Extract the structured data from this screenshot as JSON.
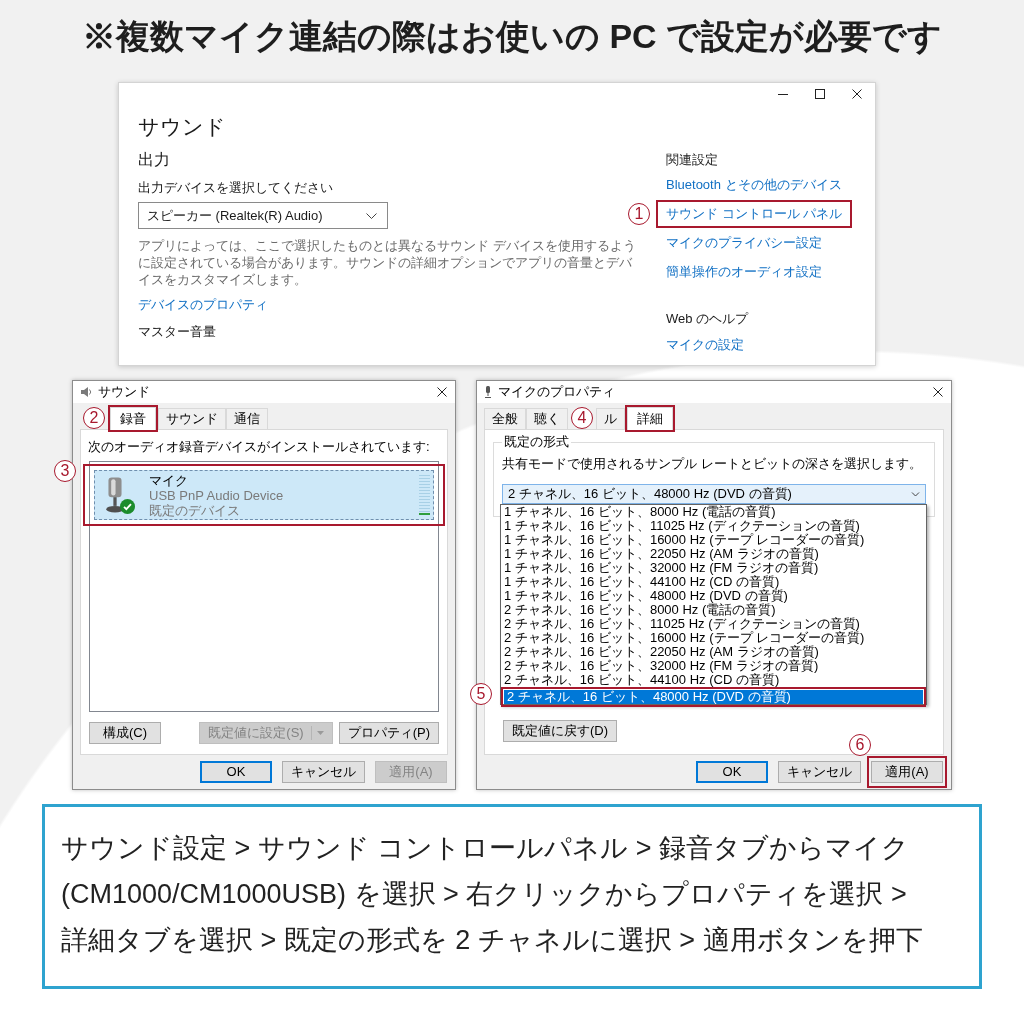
{
  "title": "※複数マイク連結の際はお使いの PC で設定が必要です",
  "settings_window": {
    "title": "サウンド",
    "output_heading": "出力",
    "device_label": "出力デバイスを選択してください",
    "device_dropdown": {
      "value": "スピーカー (Realtek(R) Audio)"
    },
    "description": "アプリによっては、ここで選択したものとは異なるサウンド デバイスを使用するように設定されている場合があります。サウンドの詳細オプションでアプリの音量とデバイスをカスタマイズします。",
    "properties_link": "デバイスのプロパティ",
    "volume_heading": "マスター音量",
    "related": {
      "heading": "関連設定",
      "links": [
        {
          "label": "Bluetooth とその他のデバイス"
        },
        {
          "label": "サウンド コントロール パネル",
          "step": "1"
        },
        {
          "label": "マイクのプライバシー設定"
        },
        {
          "label": "簡単操作のオーディオ設定"
        }
      ]
    },
    "help": {
      "heading": "Web のヘルプ",
      "links": [
        {
          "label": "マイクの設定"
        }
      ]
    }
  },
  "sound_dialog": {
    "title": "サウンド",
    "tabs": [
      {
        "label": "録音",
        "selected": true,
        "step": "2"
      },
      {
        "label": "サウンド",
        "selected": false
      },
      {
        "label": "通信",
        "selected": false
      }
    ],
    "instruction": "次のオーディオ録音デバイスがインストールされています:",
    "devices": [
      {
        "name": "マイク",
        "description": "USB PnP Audio Device",
        "status": "既定のデバイス",
        "selected": true,
        "default": true,
        "level": 0.08,
        "step": "3"
      }
    ],
    "buttons": [
      {
        "label": "構成(C)",
        "kind": "plain",
        "disabled": false
      },
      {
        "label": "既定値に設定(S)",
        "kind": "split",
        "disabled": true
      },
      {
        "label": "プロパティ(P)",
        "kind": "plain",
        "disabled": false
      }
    ],
    "footer_buttons": [
      {
        "label": "OK",
        "default": true,
        "disabled": false
      },
      {
        "label": "キャンセル",
        "default": false,
        "disabled": false
      },
      {
        "label": "適用(A)",
        "default": false,
        "disabled": true
      }
    ]
  },
  "properties_dialog": {
    "title": "マイクのプロパティ",
    "tabs": [
      {
        "label": "全般",
        "selected": false
      },
      {
        "label": "聴く",
        "selected": false
      },
      {
        "label": "ル",
        "selected": false
      },
      {
        "label": "詳細",
        "selected": true,
        "step": "4"
      }
    ],
    "format_group": {
      "heading": "既定の形式",
      "description": "共有モードで使用されるサンプル レートとビットの深さを選択します。",
      "dropdown": {
        "value": "2 チャネル、16 ビット、48000 Hz (DVD の音質)",
        "expanded": true,
        "options": [
          {
            "label": "1 チャネル、16 ビット、8000 Hz (電話の音質)",
            "selected": false
          },
          {
            "label": "1 チャネル、16 ビット、11025 Hz (ディクテーションの音質)",
            "selected": false
          },
          {
            "label": "1 チャネル、16 ビット、16000 Hz (テープ レコーダーの音質)",
            "selected": false
          },
          {
            "label": "1 チャネル、16 ビット、22050 Hz (AM ラジオの音質)",
            "selected": false
          },
          {
            "label": "1 チャネル、16 ビット、32000 Hz (FM ラジオの音質)",
            "selected": false
          },
          {
            "label": "1 チャネル、16 ビット、44100 Hz (CD の音質)",
            "selected": false
          },
          {
            "label": "1 チャネル、16 ビット、48000 Hz (DVD の音質)",
            "selected": false
          },
          {
            "label": "2 チャネル、16 ビット、8000 Hz (電話の音質)",
            "selected": false
          },
          {
            "label": "2 チャネル、16 ビット、11025 Hz (ディクテーションの音質)",
            "selected": false
          },
          {
            "label": "2 チャネル、16 ビット、16000 Hz (テープ レコーダーの音質)",
            "selected": false
          },
          {
            "label": "2 チャネル、16 ビット、22050 Hz (AM ラジオの音質)",
            "selected": false
          },
          {
            "label": "2 チャネル、16 ビット、32000 Hz (FM ラジオの音質)",
            "selected": false
          },
          {
            "label": "2 チャネル、16 ビット、44100 Hz (CD の音質)",
            "selected": false
          },
          {
            "label": "2 チャネル、16 ビット、48000 Hz (DVD の音質)",
            "selected": true,
            "step": "5"
          }
        ]
      }
    },
    "restore_button": "既定値に戻す(D)",
    "footer_buttons": [
      {
        "label": "OK",
        "default": true,
        "disabled": false
      },
      {
        "label": "キャンセル",
        "default": false,
        "disabled": false
      },
      {
        "label": "適用(A)",
        "default": false,
        "disabled": false,
        "step": "6"
      }
    ]
  },
  "instructions": "サウンド設定 > サウンド コントロールパネル > 録音タブからマイク (CM1000/CM1000USB) を選択 > 右クリックからプロパティを選択 > 詳細タブを選択 > 既定の形式を 2 チャネルに選択 > 適用ボタンを押下"
}
